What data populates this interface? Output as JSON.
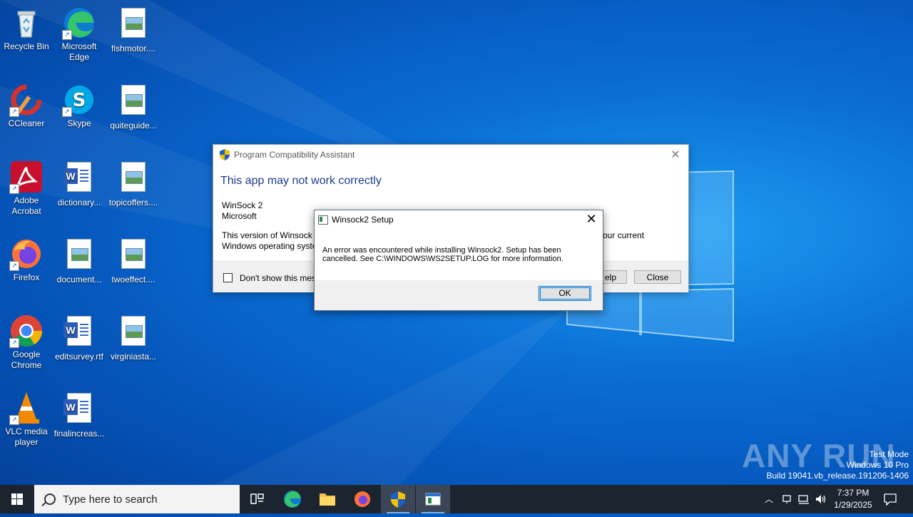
{
  "desktop": {
    "icons": [
      {
        "label": "Recycle Bin"
      },
      {
        "label": "Microsoft Edge"
      },
      {
        "label": "fishmotor...."
      },
      {
        "label": "CCleaner"
      },
      {
        "label": "Skype"
      },
      {
        "label": "quiteguide..."
      },
      {
        "label": "Adobe Acrobat"
      },
      {
        "label": "dictionary..."
      },
      {
        "label": "topicoffers...."
      },
      {
        "label": "Firefox"
      },
      {
        "label": "document..."
      },
      {
        "label": "twoeffect...."
      },
      {
        "label": "Google Chrome"
      },
      {
        "label": "editsurvey.rtf"
      },
      {
        "label": "virginiasta..."
      },
      {
        "label": "VLC media player"
      },
      {
        "label": "finalincreas..."
      }
    ]
  },
  "pca_dialog": {
    "title": "Program Compatibility Assistant",
    "heading": "This app may not work correctly",
    "app_name": "WinSock 2",
    "publisher": "Microsoft",
    "desc_line1": "This version of Winsock 2",
    "desc_line2": "Windows operating syste",
    "desc_right": "our current",
    "checkbox_label": "Don't show this mes",
    "help_label": "elp",
    "close_label": "Close"
  },
  "winsock_dialog": {
    "title": "Winsock2 Setup",
    "message_line1": "An error was encountered while installing Winsock2.  Setup has been",
    "message_line2": "cancelled.  See C:\\WINDOWS\\WS2SETUP.LOG for more information.",
    "ok_label": "OK"
  },
  "watermark": {
    "brand": "ANY RUN",
    "test_mode": "Test Mode",
    "edition": "Windows 10 Pro",
    "build": "Build 19041.vb_release.191206-1406"
  },
  "taskbar": {
    "search_placeholder": "Type here to search",
    "time": "7:37 PM",
    "date": "1/29/2025"
  }
}
